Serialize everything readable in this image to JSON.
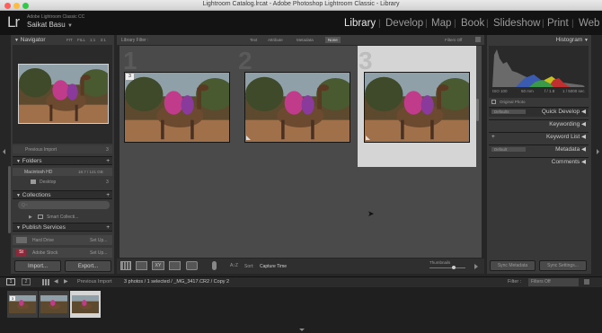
{
  "window": {
    "title": "Lightroom Catalog.lrcat - Adobe Photoshop Lightroom Classic - Library"
  },
  "identity": {
    "logo": "Lr",
    "product": "Adobe Lightroom Classic CC",
    "user": "Saikat Basu",
    "user_arrow": "▼"
  },
  "modules": [
    "Library",
    "Develop",
    "Map",
    "Book",
    "Slideshow",
    "Print",
    "Web"
  ],
  "active_module": "Library",
  "left_panel": {
    "navigator": {
      "title": "Navigator",
      "zoom_options": [
        "FIT",
        "FILL",
        "1:1",
        "3:1"
      ]
    },
    "catalog_item": {
      "label": "Previous Import",
      "count": "3"
    },
    "folders": {
      "title": "Folders",
      "drive": "Macintosh HD",
      "drive_space": "18.7 / 121 GB",
      "folder": "Desktop",
      "folder_count": "3"
    },
    "collections": {
      "title": "Collections",
      "search_placeholder": "Q~",
      "smart": "Smart Collecti..."
    },
    "publish": {
      "title": "Publish Services",
      "items": [
        {
          "name": "Hard Drive",
          "action": "Set Up..."
        },
        {
          "name": "Adobe Stock",
          "action": "Set Up..."
        }
      ]
    },
    "import_label": "Import...",
    "export_label": "Export..."
  },
  "filter_bar": {
    "title": "Library Filter :",
    "options": [
      "Text",
      "Attribute",
      "Metadata",
      "None"
    ],
    "active": "None",
    "filters_off": "Filters Off"
  },
  "grid": {
    "cells": [
      {
        "number": "1",
        "badge": "3",
        "selected": false
      },
      {
        "number": "2",
        "badge": "",
        "selected": false
      },
      {
        "number": "3",
        "badge": "",
        "selected": true
      }
    ]
  },
  "toolbar": {
    "sort_label": "Sort:",
    "sort_value": "Capture Time",
    "thumbnails_label": "Thumbnails"
  },
  "right_panel": {
    "histogram": {
      "title": "Histogram",
      "iso": "ISO 100",
      "focal": "50 mm",
      "aperture": "f / 1.8",
      "shutter": "1 / 5000 sec",
      "original_photo": "Original Photo"
    },
    "quick_develop": {
      "preset": "Defaults",
      "title": "Quick Develop"
    },
    "keywording": "Keywording",
    "keyword_list": "Keyword List",
    "metadata": {
      "preset": "Default",
      "title": "Metadata"
    },
    "comments": "Comments",
    "sync_metadata": "Sync Metadata",
    "sync_settings": "Sync Settings..."
  },
  "filmstrip_bar": {
    "page1": "1",
    "page2": "2",
    "source": "Previous Import",
    "info": "3 photos / 1 selected / _MG_3417.CR2 / Copy 2",
    "filter_label": "Filter :",
    "filter_value": "Filters Off"
  }
}
